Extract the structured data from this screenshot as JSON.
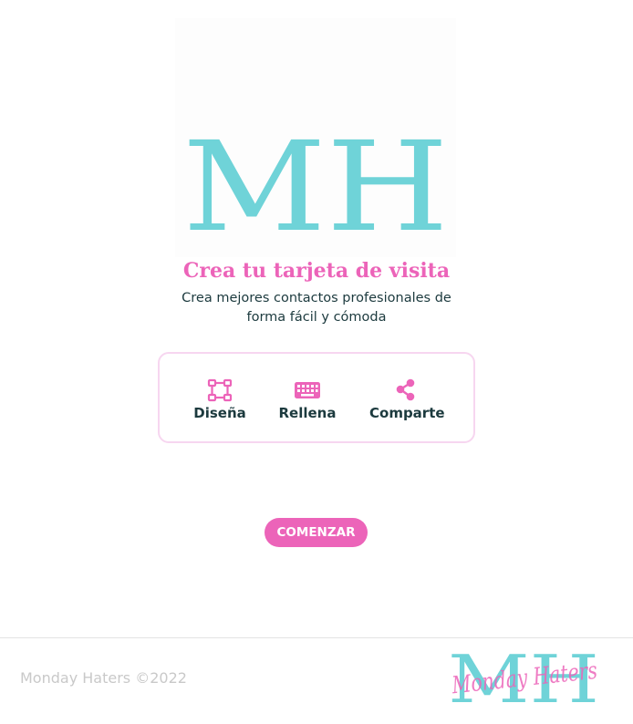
{
  "hero": {
    "logo_text": "MH",
    "logo_icon": "mh-monogram-logo",
    "logo_color": "#6fd3d8"
  },
  "intro": {
    "title": "Crea tu tarjeta de visita",
    "subtitle_line1": "Crea mejores contactos profesionales de",
    "subtitle_line2": "forma fácil y cómoda"
  },
  "steps": [
    {
      "icon": "vector-design-icon",
      "label": "Diseña"
    },
    {
      "icon": "keyboard-icon",
      "label": "Rellena"
    },
    {
      "icon": "share-icon",
      "label": "Comparte"
    }
  ],
  "cta": {
    "label": "COMENZAR"
  },
  "footer": {
    "copyright": "Monday Haters ©2022",
    "logo_text": "MH",
    "logo_script": "Monday Haters"
  },
  "colors": {
    "accent": "#ec64b9",
    "teal": "#6fd3d8",
    "text_dark": "#1c3a3e",
    "border": "#f7d6f0"
  }
}
